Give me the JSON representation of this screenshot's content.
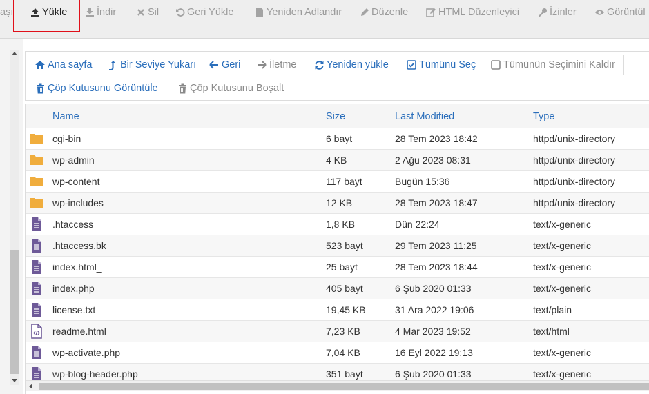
{
  "toolbar": {
    "partial_left": "aşı",
    "upload": "Yükle",
    "download": "İndir",
    "delete": "Sil",
    "restore": "Geri Yükle",
    "rename": "Yeniden Adlandır",
    "edit": "Düzenle",
    "html_editor": "HTML Düzenleyici",
    "permissions": "İzinler",
    "view": "Görüntül"
  },
  "nav": {
    "home": "Ana sayfa",
    "up_one_level": "Bir Seviye Yukarı",
    "back": "Geri",
    "forward": "İletme",
    "reload": "Yeniden yükle",
    "select_all": "Tümünü Seç",
    "deselect_all": "Tümünün Seçimini Kaldır",
    "view_trash": "Çöp Kutusunu Görüntüle",
    "empty_trash": "Çöp Kutusunu Boşalt"
  },
  "table": {
    "headers": {
      "name": "Name",
      "size": "Size",
      "modified": "Last Modified",
      "type": "Type"
    },
    "rows": [
      {
        "icon": "folder",
        "name": "cgi-bin",
        "size": "6 bayt",
        "modified": "28 Tem 2023 18:42",
        "type": "httpd/unix-directory"
      },
      {
        "icon": "folder",
        "name": "wp-admin",
        "size": "4 KB",
        "modified": "2 Ağu 2023 08:31",
        "type": "httpd/unix-directory"
      },
      {
        "icon": "folder",
        "name": "wp-content",
        "size": "117 bayt",
        "modified": "Bugün 15:36",
        "type": "httpd/unix-directory"
      },
      {
        "icon": "folder",
        "name": "wp-includes",
        "size": "12 KB",
        "modified": "28 Tem 2023 18:47",
        "type": "httpd/unix-directory"
      },
      {
        "icon": "file",
        "name": ".htaccess",
        "size": "1,8 KB",
        "modified": "Dün 22:24",
        "type": "text/x-generic"
      },
      {
        "icon": "file",
        "name": ".htaccess.bk",
        "size": "523 bayt",
        "modified": "29 Tem 2023 11:25",
        "type": "text/x-generic"
      },
      {
        "icon": "file",
        "name": "index.html_",
        "size": "25 bayt",
        "modified": "28 Tem 2023 18:44",
        "type": "text/x-generic"
      },
      {
        "icon": "file",
        "name": "index.php",
        "size": "405 bayt",
        "modified": "6 Şub 2020 01:33",
        "type": "text/x-generic"
      },
      {
        "icon": "file",
        "name": "license.txt",
        "size": "19,45 KB",
        "modified": "31 Ara 2022 19:06",
        "type": "text/plain"
      },
      {
        "icon": "html",
        "name": "readme.html",
        "size": "7,23 KB",
        "modified": "4 Mar 2023 19:52",
        "type": "text/html"
      },
      {
        "icon": "file",
        "name": "wp-activate.php",
        "size": "7,04 KB",
        "modified": "16 Eyl 2022 19:13",
        "type": "text/x-generic"
      },
      {
        "icon": "file",
        "name": "wp-blog-header.php",
        "size": "351 bayt",
        "modified": "6 Şub 2020 01:33",
        "type": "text/x-generic"
      }
    ]
  },
  "colors": {
    "accent": "#2a6ebb",
    "folder": "#f0ad3d",
    "file": "#6e5a98",
    "highlight": "#e0101a"
  }
}
